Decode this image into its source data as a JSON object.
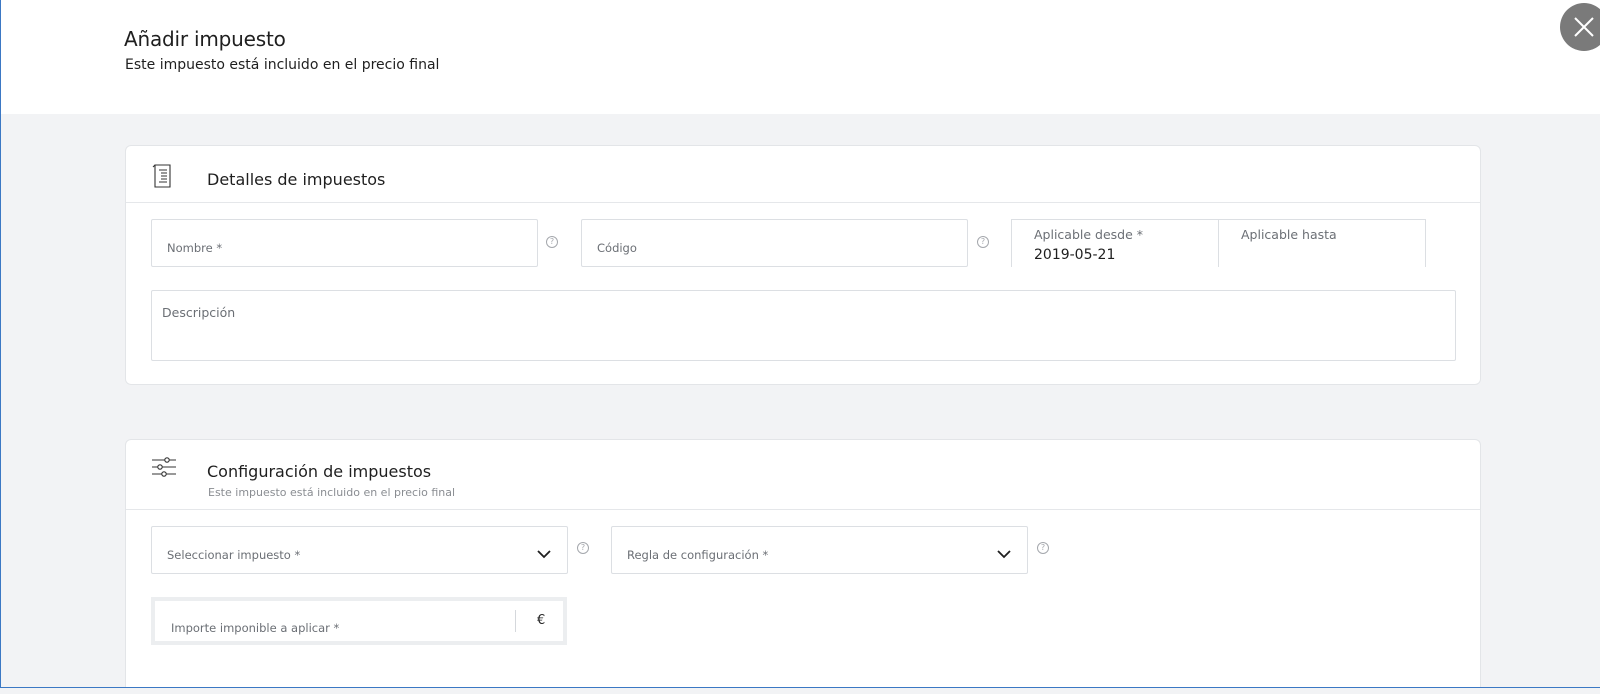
{
  "header": {
    "title": "Añadir impuesto",
    "subtitle": "Este impuesto está incluido en el precio final",
    "close_icon": "close-icon"
  },
  "details": {
    "title": "Detalles de impuestos",
    "icon": "receipt-icon",
    "name_label": "Nombre *",
    "code_label": "Código",
    "from_label": "Aplicable desde *",
    "from_value": "2019-05-21",
    "to_label": "Aplicable hasta",
    "description_label": "Descripción",
    "help_glyph": "?"
  },
  "config": {
    "title": "Configuración de impuestos",
    "hint": "Este impuesto está incluido en el precio final",
    "icon": "sliders-icon",
    "tax_select_label": "Seleccionar impuesto *",
    "rule_select_label": "Regla de configuración *",
    "amount_label": "Importe imponible a aplicar *",
    "currency": "€"
  },
  "colors": {
    "background": "#f2f3f5",
    "card": "#ffffff",
    "close_button": "#7a7a7a",
    "window_border": "#3b78c4"
  }
}
